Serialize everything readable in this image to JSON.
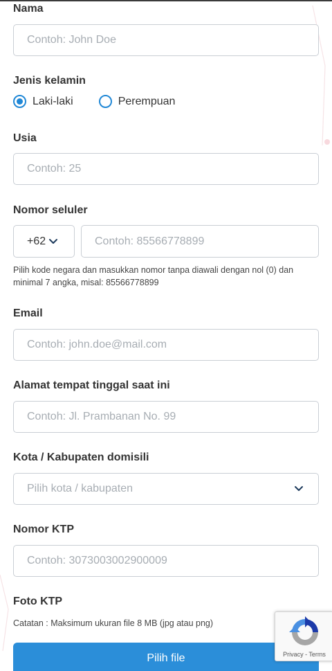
{
  "form": {
    "name": {
      "label": "Nama",
      "placeholder": "Contoh: John Doe"
    },
    "gender": {
      "label": "Jenis kelamin",
      "options": [
        {
          "label": "Laki-laki",
          "selected": true
        },
        {
          "label": "Perempuan",
          "selected": false
        }
      ]
    },
    "age": {
      "label": "Usia",
      "placeholder": "Contoh: 25"
    },
    "phone": {
      "label": "Nomor seluler",
      "country_code": "+62",
      "placeholder": "Contoh: 85566778899",
      "help": "Pilih kode negara dan masukkan nomor tanpa diawali dengan nol (0) dan minimal 7 angka, misal: 85566778899"
    },
    "email": {
      "label": "Email",
      "placeholder": "Contoh: john.doe@mail.com"
    },
    "address": {
      "label": "Alamat tempat tinggal saat ini",
      "placeholder": "Contoh: Jl. Prambanan No. 99"
    },
    "city": {
      "label": "Kota / Kabupaten domisili",
      "placeholder": "Pilih kota / kabupaten"
    },
    "ktp_number": {
      "label": "Nomor KTP",
      "placeholder": "Contoh: 3073003002900009"
    },
    "ktp_photo": {
      "label": "Foto KTP",
      "note": "Catatan : Maksimum ukuran file 8 MB (jpg atau png)",
      "button_label": "Pilih file"
    }
  },
  "recaptcha": {
    "links": "Privacy - Terms"
  },
  "colors": {
    "accent": "#1f87d6",
    "button": "#2b8ed9",
    "border": "#c9ced4",
    "placeholder": "#a7adb3"
  },
  "icons": [
    "chevron-down-icon",
    "recaptcha-logo-icon"
  ]
}
